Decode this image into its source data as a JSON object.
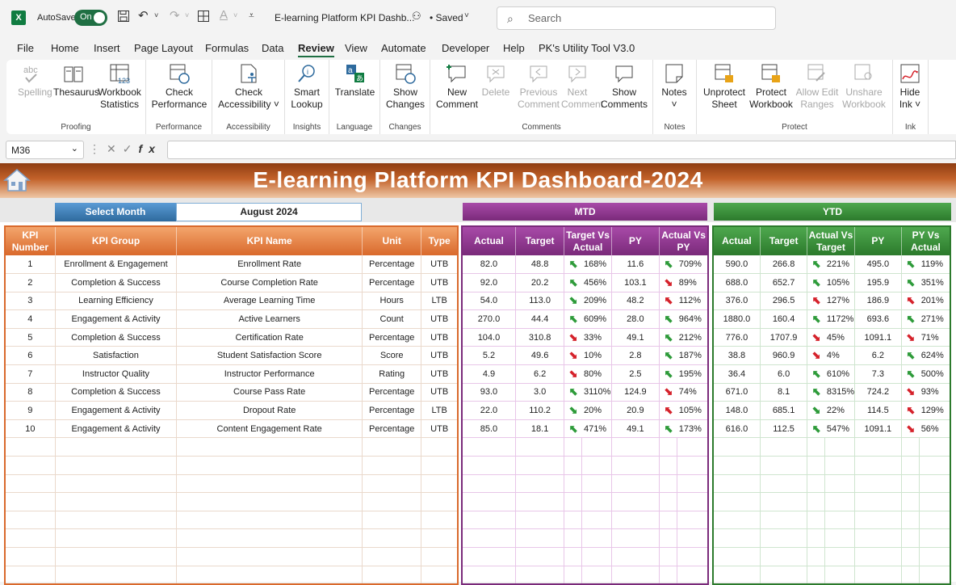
{
  "titlebar": {
    "autosave_label": "AutoSave",
    "toggle_label": "On",
    "doc_title": "E-learning Platform KPI Dashb...",
    "saved_label": "• Saved",
    "search_placeholder": "Search"
  },
  "menu": [
    "File",
    "Home",
    "Insert",
    "Page Layout",
    "Formulas",
    "Data",
    "Review",
    "View",
    "Automate",
    "Developer",
    "Help",
    "PK's Utility Tool V3.0"
  ],
  "active_menu": "Review",
  "ribbon": {
    "groups": [
      {
        "label": "Proofing",
        "buttons": [
          {
            "label": "Spelling",
            "icon": "spelling-icon",
            "disabled": true
          },
          {
            "label": "Thesaurus",
            "icon": "thesaurus-icon",
            "disabled": false
          },
          {
            "label": "Workbook Statistics",
            "icon": "workbook-statistics-icon",
            "disabled": false
          }
        ]
      },
      {
        "label": "Performance",
        "buttons": [
          {
            "label": "Check Performance",
            "icon": "check-performance-icon",
            "disabled": false
          }
        ]
      },
      {
        "label": "Accessibility",
        "buttons": [
          {
            "label": "Check Accessibility ˅",
            "icon": "accessibility-icon",
            "disabled": false
          }
        ]
      },
      {
        "label": "Insights",
        "buttons": [
          {
            "label": "Smart Lookup",
            "icon": "smart-lookup-icon",
            "disabled": false
          }
        ]
      },
      {
        "label": "Language",
        "buttons": [
          {
            "label": "Translate",
            "icon": "translate-icon",
            "disabled": false
          }
        ]
      },
      {
        "label": "Changes",
        "buttons": [
          {
            "label": "Show Changes",
            "icon": "show-changes-icon",
            "disabled": false
          }
        ]
      },
      {
        "label": "Comments",
        "buttons": [
          {
            "label": "New Comment",
            "icon": "new-comment-icon",
            "disabled": false
          },
          {
            "label": "Delete",
            "icon": "delete-comment-icon",
            "disabled": true
          },
          {
            "label": "Previous Comment",
            "icon": "previous-comment-icon",
            "disabled": true
          },
          {
            "label": "Next Comment",
            "icon": "next-comment-icon",
            "disabled": true
          },
          {
            "label": "Show Comments",
            "icon": "show-comments-icon",
            "disabled": false
          }
        ]
      },
      {
        "label": "Notes",
        "buttons": [
          {
            "label": "Notes ˅",
            "icon": "notes-icon",
            "disabled": false
          }
        ]
      },
      {
        "label": "Protect",
        "buttons": [
          {
            "label": "Unprotect Sheet",
            "icon": "unprotect-sheet-icon",
            "disabled": false
          },
          {
            "label": "Protect Workbook",
            "icon": "protect-workbook-icon",
            "disabled": false
          },
          {
            "label": "Allow Edit Ranges",
            "icon": "allow-edit-ranges-icon",
            "disabled": true
          },
          {
            "label": "Unshare Workbook",
            "icon": "unshare-workbook-icon",
            "disabled": true
          }
        ]
      },
      {
        "label": "Ink",
        "buttons": [
          {
            "label": "Hide Ink ˅",
            "icon": "hide-ink-icon",
            "disabled": false
          }
        ]
      }
    ]
  },
  "formula_bar": {
    "name_box": "M36",
    "formula": ""
  },
  "dashboard": {
    "title": "E-learning Platform KPI Dashboard-2024",
    "select_month_label": "Select Month",
    "selected_month": "August 2024",
    "mtd_label": "MTD",
    "ytd_label": "YTD",
    "main_headers": [
      "KPI Number",
      "KPI Group",
      "KPI Name",
      "Unit",
      "Type"
    ],
    "mtd_headers": [
      "Actual",
      "Target",
      "Target Vs Actual",
      "PY",
      "Actual Vs PY"
    ],
    "ytd_headers": [
      "Actual",
      "Target",
      "Actual Vs Target",
      "PY",
      "PY Vs Actual"
    ],
    "colors": {
      "up": "#2e9b3a",
      "down": "#d5222b",
      "main": "#d9692c",
      "mtd": "#7a2a7a",
      "ytd": "#2c7a2c"
    },
    "rows": [
      {
        "num": "1",
        "group": "Enrollment & Engagement",
        "name": "Enrollment Rate",
        "unit": "Percentage",
        "type": "UTB",
        "mtd": {
          "actual": "82.0",
          "target": "48.8",
          "tva_dir": "up",
          "tva": "168%",
          "py": "11.6",
          "avp_dir": "up",
          "avp": "709%"
        },
        "ytd": {
          "actual": "590.0",
          "target": "266.8",
          "avt_dir": "up",
          "avt": "221%",
          "py": "495.0",
          "pva_dir": "up",
          "pva": "119%"
        }
      },
      {
        "num": "2",
        "group": "Completion & Success",
        "name": "Course Completion Rate",
        "unit": "Percentage",
        "type": "UTB",
        "mtd": {
          "actual": "92.0",
          "target": "20.2",
          "tva_dir": "up",
          "tva": "456%",
          "py": "103.1",
          "avp_dir": "down",
          "avp": "89%"
        },
        "ytd": {
          "actual": "688.0",
          "target": "652.7",
          "avt_dir": "up",
          "avt": "105%",
          "py": "195.9",
          "pva_dir": "up",
          "pva": "351%"
        }
      },
      {
        "num": "3",
        "group": "Learning Efficiency",
        "name": "Average Learning Time",
        "unit": "Hours",
        "type": "LTB",
        "mtd": {
          "actual": "54.0",
          "target": "113.0",
          "tva_dir": "up-r",
          "tva": "209%",
          "py": "48.2",
          "avp_dir": "down-r",
          "avp": "112%"
        },
        "ytd": {
          "actual": "376.0",
          "target": "296.5",
          "avt_dir": "down-r",
          "avt": "127%",
          "py": "186.9",
          "pva_dir": "down-r",
          "pva": "201%"
        }
      },
      {
        "num": "4",
        "group": "Engagement & Activity",
        "name": "Active Learners",
        "unit": "Count",
        "type": "UTB",
        "mtd": {
          "actual": "270.0",
          "target": "44.4",
          "tva_dir": "up",
          "tva": "609%",
          "py": "28.0",
          "avp_dir": "up",
          "avp": "964%"
        },
        "ytd": {
          "actual": "1880.0",
          "target": "160.4",
          "avt_dir": "up",
          "avt": "1172%",
          "py": "693.6",
          "avp": "",
          "pva_dir": "up",
          "pva": "271%"
        }
      },
      {
        "num": "5",
        "group": "Completion & Success",
        "name": "Certification Rate",
        "unit": "Percentage",
        "type": "UTB",
        "mtd": {
          "actual": "104.0",
          "target": "310.8",
          "tva_dir": "down",
          "tva": "33%",
          "py": "49.1",
          "avp_dir": "up",
          "avp": "212%"
        },
        "ytd": {
          "actual": "776.0",
          "target": "1707.9",
          "avt_dir": "down",
          "avt": "45%",
          "py": "1091.1",
          "pva_dir": "down",
          "pva": "71%"
        }
      },
      {
        "num": "6",
        "group": "Satisfaction",
        "name": "Student Satisfaction Score",
        "unit": "Score",
        "type": "UTB",
        "mtd": {
          "actual": "5.2",
          "target": "49.6",
          "tva_dir": "down",
          "tva": "10%",
          "py": "2.8",
          "avp_dir": "up",
          "avp": "187%"
        },
        "ytd": {
          "actual": "38.8",
          "target": "960.9",
          "avt_dir": "down",
          "avt": "4%",
          "py": "6.2",
          "pva_dir": "up",
          "pva": "624%"
        }
      },
      {
        "num": "7",
        "group": "Instructor Quality",
        "name": "Instructor Performance",
        "unit": "Rating",
        "type": "UTB",
        "mtd": {
          "actual": "4.9",
          "target": "6.2",
          "tva_dir": "down",
          "tva": "80%",
          "py": "2.5",
          "avp_dir": "up",
          "avp": "195%"
        },
        "ytd": {
          "actual": "36.4",
          "target": "6.0",
          "avt_dir": "up",
          "avt": "610%",
          "py": "7.3",
          "pva_dir": "up",
          "pva": "500%"
        }
      },
      {
        "num": "8",
        "group": "Completion & Success",
        "name": "Course Pass Rate",
        "unit": "Percentage",
        "type": "UTB",
        "mtd": {
          "actual": "93.0",
          "target": "3.0",
          "tva_dir": "up",
          "tva": "3110%",
          "py": "124.9",
          "avp_dir": "down",
          "avp": "74%"
        },
        "ytd": {
          "actual": "671.0",
          "target": "8.1",
          "avt_dir": "up",
          "avt": "8315%",
          "py": "724.2",
          "pva_dir": "down",
          "pva": "93%"
        }
      },
      {
        "num": "9",
        "group": "Engagement & Activity",
        "name": "Dropout Rate",
        "unit": "Percentage",
        "type": "LTB",
        "mtd": {
          "actual": "22.0",
          "target": "110.2",
          "tva_dir": "up-r",
          "tva": "20%",
          "py": "20.9",
          "avp_dir": "down-r",
          "avp": "105%"
        },
        "ytd": {
          "actual": "148.0",
          "target": "685.1",
          "avt_dir": "up-r",
          "avt": "22%",
          "py": "114.5",
          "pva_dir": "down-r",
          "pva": "129%"
        }
      },
      {
        "num": "10",
        "group": "Engagement & Activity",
        "name": "Content Engagement Rate",
        "unit": "Percentage",
        "type": "UTB",
        "mtd": {
          "actual": "85.0",
          "target": "18.1",
          "tva_dir": "up",
          "tva": "471%",
          "py": "49.1",
          "avp_dir": "up",
          "avp": "173%"
        },
        "ytd": {
          "actual": "616.0",
          "target": "112.5",
          "avt_dir": "up",
          "avt": "547%",
          "py": "1091.1",
          "pva_dir": "down",
          "pva": "56%"
        }
      }
    ]
  }
}
